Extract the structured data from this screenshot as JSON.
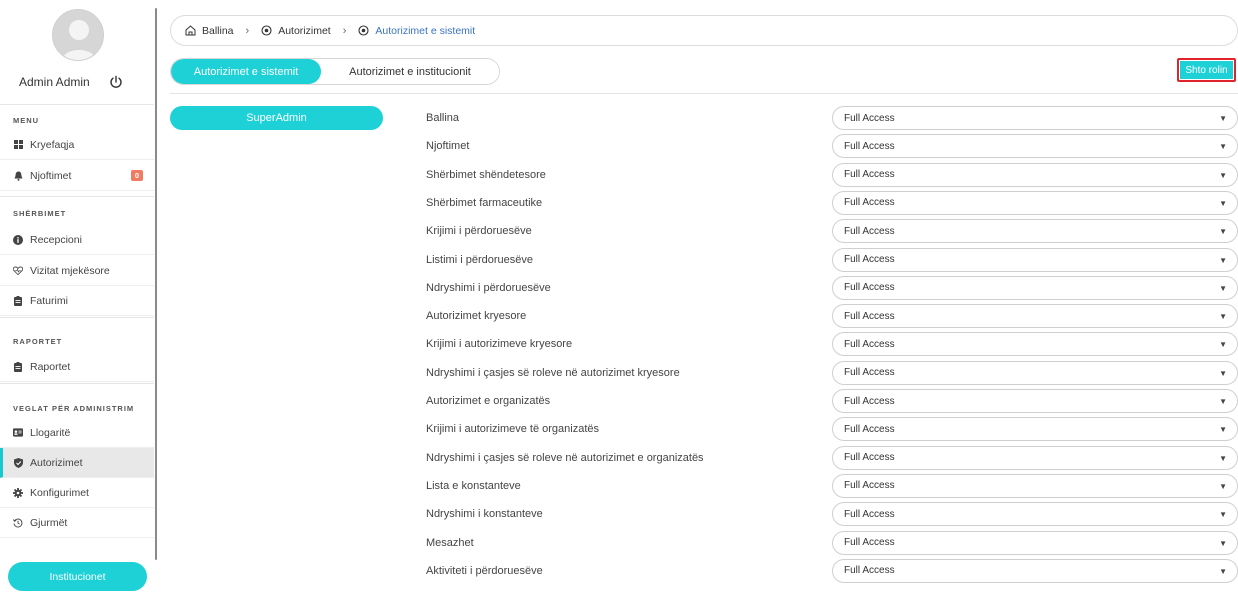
{
  "user": {
    "name": "Admin Admin"
  },
  "menu": {
    "section_menu": "MENU",
    "section_services": "SHËRBIMET",
    "section_reports": "RAPORTET",
    "section_admin": "VEGLAT PËR ADMINISTRIM",
    "items": [
      {
        "label": "Kryefaqja",
        "icon": "dashboard-icon"
      },
      {
        "label": "Njoftimet",
        "icon": "bell-icon",
        "badge": "0"
      },
      {
        "label": "Recepcioni",
        "icon": "info-icon"
      },
      {
        "label": "Vizitat mjekësore",
        "icon": "heart-icon"
      },
      {
        "label": "Faturimi",
        "icon": "clipboard-icon"
      },
      {
        "label": "Raportet",
        "icon": "clipboard-icon"
      },
      {
        "label": "Llogaritë",
        "icon": "id-card-icon"
      },
      {
        "label": "Autorizimet",
        "icon": "shield-icon"
      },
      {
        "label": "Konfigurimet",
        "icon": "cog-icon"
      },
      {
        "label": "Gjurmët",
        "icon": "history-icon"
      }
    ],
    "institutions_button": "Institucionet"
  },
  "breadcrumb": {
    "home": "Ballina",
    "level1": "Autorizimet",
    "current": "Autorizimet e sistemit"
  },
  "tabs": {
    "system": "Autorizimet e sistemit",
    "institution": "Autorizimet e institucionit"
  },
  "add_role_label": "Shto rolin",
  "role": "SuperAdmin",
  "permissions": [
    {
      "label": "Ballina",
      "value": "Full Access"
    },
    {
      "label": "Njoftimet",
      "value": "Full Access"
    },
    {
      "label": "Shërbimet shëndetesore",
      "value": "Full Access"
    },
    {
      "label": "Shërbimet farmaceutike",
      "value": "Full Access"
    },
    {
      "label": "Krijimi i përdoruesëve",
      "value": "Full Access"
    },
    {
      "label": "Listimi i përdoruesëve",
      "value": "Full Access"
    },
    {
      "label": "Ndryshimi i përdoruesëve",
      "value": "Full Access"
    },
    {
      "label": "Autorizimet kryesore",
      "value": "Full Access"
    },
    {
      "label": "Krijimi i autorizimeve kryesore",
      "value": "Full Access"
    },
    {
      "label": "Ndryshimi i çasjes së roleve në autorizimet kryesore",
      "value": "Full Access"
    },
    {
      "label": "Autorizimet e organizatës",
      "value": "Full Access"
    },
    {
      "label": "Krijimi i autorizimeve të organizatës",
      "value": "Full Access"
    },
    {
      "label": "Ndryshimi i çasjes së roleve në autorizimet e organizatës",
      "value": "Full Access"
    },
    {
      "label": "Lista e konstanteve",
      "value": "Full Access"
    },
    {
      "label": "Ndryshimi i konstanteve",
      "value": "Full Access"
    },
    {
      "label": "Mesazhet",
      "value": "Full Access"
    },
    {
      "label": "Aktiviteti i përdoruesëve",
      "value": "Full Access"
    }
  ],
  "colors": {
    "accent": "#1ed1d6",
    "highlight": "#e0242d",
    "badge": "#f07b63",
    "link": "#3a73c4"
  }
}
